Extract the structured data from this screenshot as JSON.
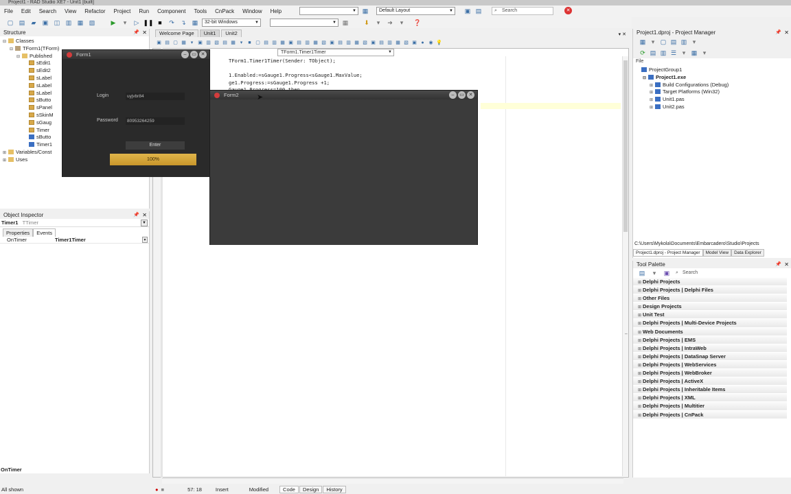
{
  "app": {
    "title": "Project1 - RAD Studio XE7 - Unit1 [built]"
  },
  "menu": [
    "File",
    "Edit",
    "Search",
    "View",
    "Refactor",
    "Project",
    "Run",
    "Component",
    "Tools",
    "CnPack",
    "Window",
    "Help"
  ],
  "toolbar": {
    "platform": "32-bit Windows",
    "layout": "Default Layout",
    "search_placeholder": "Search"
  },
  "structure": {
    "title": "Structure",
    "rows": [
      {
        "label": "Classes",
        "indent": 0,
        "exp": "−",
        "icon": "folder"
      },
      {
        "label": "TForm1(TForm)",
        "indent": 1,
        "exp": "−",
        "icon": "cls"
      },
      {
        "label": "Published",
        "indent": 2,
        "exp": "−",
        "icon": "folder"
      },
      {
        "label": "sEdit1",
        "indent": 3,
        "exp": "",
        "icon": "comp"
      },
      {
        "label": "sEdit2",
        "indent": 3,
        "exp": "",
        "icon": "comp"
      },
      {
        "label": "sLabel",
        "indent": 3,
        "exp": "",
        "icon": "comp"
      },
      {
        "label": "sLabel",
        "indent": 3,
        "exp": "",
        "icon": "comp"
      },
      {
        "label": "sLabel",
        "indent": 3,
        "exp": "",
        "icon": "comp"
      },
      {
        "label": "sButto",
        "indent": 3,
        "exp": "",
        "icon": "comp"
      },
      {
        "label": "sPanel",
        "indent": 3,
        "exp": "",
        "icon": "comp"
      },
      {
        "label": "sSkinM",
        "indent": 3,
        "exp": "",
        "icon": "comp"
      },
      {
        "label": "sGaug",
        "indent": 3,
        "exp": "",
        "icon": "comp"
      },
      {
        "label": "Timer",
        "indent": 3,
        "exp": "",
        "icon": "comp"
      },
      {
        "label": "sButto",
        "indent": 3,
        "exp": "",
        "icon": "blue"
      },
      {
        "label": "Timer1",
        "indent": 3,
        "exp": "",
        "icon": "blue"
      },
      {
        "label": "Variables/Const",
        "indent": 0,
        "exp": "+",
        "icon": "folder"
      },
      {
        "label": "Uses",
        "indent": 0,
        "exp": "+",
        "icon": "folder"
      }
    ]
  },
  "inspector": {
    "title": "Object Inspector",
    "selected_name": "Timer1",
    "selected_type": "TTimer",
    "tabs": [
      "Properties",
      "Events"
    ],
    "rows": [
      {
        "key": "OnTimer",
        "value": "Timer1Timer"
      }
    ],
    "footer": "OnTimer",
    "status": "All shown"
  },
  "editor": {
    "tabs": [
      "Welcome Page",
      "Unit1",
      "Unit2"
    ],
    "method_combo": "TForm1.Timer1Timer",
    "code_lines": [
      "TForm1.Timer1Timer(Sender: TObject);",
      "",
      "1.Enabled:=sGauge1.Progress<sGauge1.MaxValue;",
      "ge1.Progress:=sGauge1.Progress +1;",
      "Gauge1.Progress=100 then"
    ],
    "status": {
      "position": "57: 18",
      "mode": "Insert",
      "state": "Modified"
    },
    "view_tabs": [
      "Code",
      "Design",
      "History"
    ]
  },
  "project_manager": {
    "title": "Project1.dproj - Project Manager",
    "file_label": "File",
    "tree": [
      {
        "label": "ProjectGroup1",
        "indent": 0,
        "bold": false
      },
      {
        "label": "Project1.exe",
        "indent": 1,
        "bold": true
      },
      {
        "label": "Build Configurations (Debug)",
        "indent": 2,
        "bold": false
      },
      {
        "label": "Target Platforms (Win32)",
        "indent": 2,
        "bold": false
      },
      {
        "label": "Unit1.pas",
        "indent": 2,
        "bold": false
      },
      {
        "label": "Unit2.pas",
        "indent": 2,
        "bold": false
      }
    ],
    "path": "C:\\Users\\Mykola\\Documents\\Embarcadero\\Studio\\Projects",
    "tabs": [
      "Project1.dproj - Project Manager",
      "Model View",
      "Data Explorer"
    ]
  },
  "tool_palette": {
    "title": "Tool Palette",
    "search_placeholder": "Search",
    "items": [
      "Delphi Projects",
      "Delphi Projects | Delphi Files",
      "Other Files",
      "Design Projects",
      "Unit Test",
      "Delphi Projects | Multi-Device Projects",
      "Web Documents",
      "Delphi Projects | EMS",
      "Delphi Projects | IntraWeb",
      "Delphi Projects | DataSnap Server",
      "Delphi Projects | WebServices",
      "Delphi Projects | WebBroker",
      "Delphi Projects | ActiveX",
      "Delphi Projects | Inheritable Items",
      "Delphi Projects | XML",
      "Delphi Projects | Multitier",
      "Delphi Projects | CnPack"
    ]
  },
  "form1": {
    "title": "Form1",
    "login_label": "Login",
    "login_value": "uyjvbr84",
    "password_label": "Password",
    "password_value": "80953264259",
    "enter_label": "Enter",
    "progress_text": "100%",
    "progress_value": 1.0,
    "accent": "#c8962b"
  },
  "form2": {
    "title": "Form2"
  }
}
